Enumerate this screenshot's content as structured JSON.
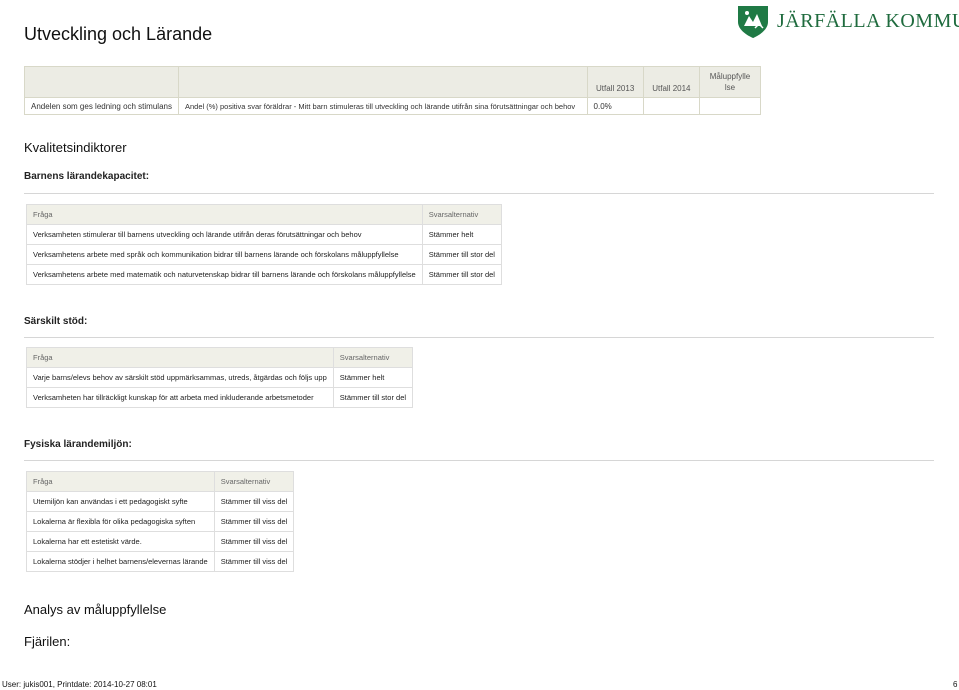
{
  "header": {
    "title": "Utveckling och Lärande",
    "logo_text": "JÄRFÄLLA KOMMUN"
  },
  "kpi_table": {
    "col_utfall_2013": "Utfall  2013",
    "col_utfall_2014": "Utfall  2014",
    "col_maluppfyllelse": "Måluppfylle lse",
    "row_label": "Andelen som  ges ledning och stimulans",
    "row_desc": "Andel (%) positiva svar föräldrar - Mitt barn stimuleras till utveckling och lärande utifrån sina förutsättningar och behov",
    "row_value": "0.0%"
  },
  "section_title": "Kvalitetsindiktorer",
  "groups": [
    {
      "title": "Barnens lärandekapacitet:",
      "header_q": "Fråga",
      "header_a": "Svarsalternativ",
      "rows": [
        {
          "q": "Verksamheten stimulerar till barnens utveckling och lärande utifrån deras förutsättningar och behov",
          "a": "Stämmer helt"
        },
        {
          "q": "Verksamhetens arbete med språk och kommunikation bidrar till barnens lärande och förskolans måluppfyllelse",
          "a": "Stämmer till stor del"
        },
        {
          "q": "Verksamhetens arbete med matematik och naturvetenskap bidrar till barnens lärande och förskolans måluppfyllelse",
          "a": "Stämmer till stor del"
        }
      ]
    },
    {
      "title": "Särskilt stöd:",
      "header_q": "Fråga",
      "header_a": "Svarsalternativ",
      "rows": [
        {
          "q": "Varje barns/elevs behov av särskilt stöd uppmärksammas, utreds, åtgärdas och följs upp",
          "a": "Stämmer helt"
        },
        {
          "q": "Verksamheten har tillräckligt kunskap för att arbeta med inkluderande arbetsmetoder",
          "a": "Stämmer till stor del"
        }
      ]
    },
    {
      "title": "Fysiska lärandemiljön:",
      "header_q": "Fråga",
      "header_a": "Svarsalternativ",
      "rows": [
        {
          "q": "Utemiljön kan användas i ett pedagogiskt syfte",
          "a": "Stämmer till viss del"
        },
        {
          "q": "Lokalerna är flexibla för olika pedagogiska syften",
          "a": "Stämmer till viss del"
        },
        {
          "q": "Lokalerna har ett estetiskt värde.",
          "a": "Stämmer till viss del"
        },
        {
          "q": "Lokalerna stödjer i helhet barnens/elevernas lärande",
          "a": "Stämmer till viss del"
        }
      ]
    }
  ],
  "analysis_title": "Analys av måluppfyllelse",
  "fjarilen_title": "Fjärilen:",
  "footer": {
    "user_line": "User: jukis001, Printdate: 2014-10-27 08:01",
    "page_number": "6"
  }
}
